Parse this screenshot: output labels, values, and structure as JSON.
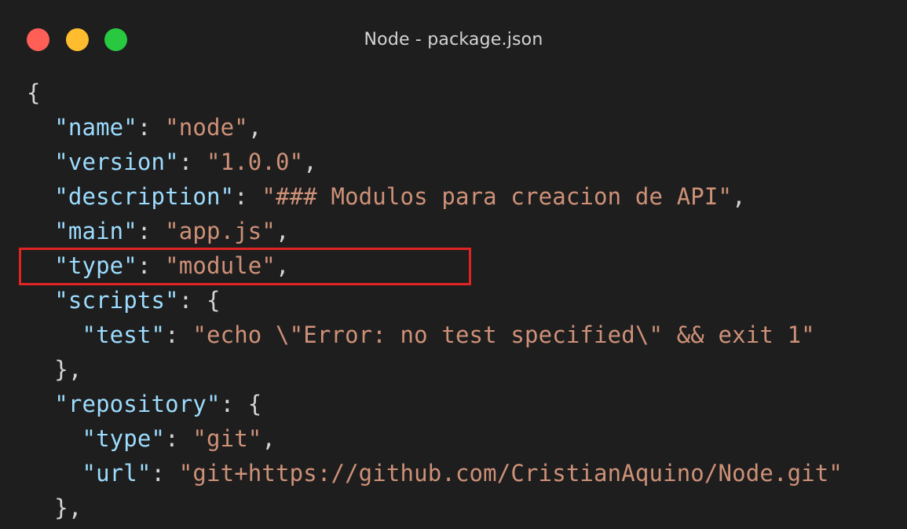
{
  "window": {
    "title": "Node - package.json",
    "traffic_lights": [
      {
        "name": "close",
        "color": "#ff5f57"
      },
      {
        "name": "minimize",
        "color": "#febc2e"
      },
      {
        "name": "maximize",
        "color": "#28c840"
      }
    ]
  },
  "colors": {
    "background": "#1e1e1e",
    "key": "#9cdcfe",
    "string": "#ce9178",
    "punctuation": "#d4d4d4",
    "highlight_border": "#e02424"
  },
  "code": {
    "lines": [
      [
        {
          "t": "p",
          "v": "{"
        }
      ],
      [
        {
          "t": "p",
          "v": "  "
        },
        {
          "t": "k",
          "v": "\"name\""
        },
        {
          "t": "p",
          "v": ": "
        },
        {
          "t": "s",
          "v": "\"node\""
        },
        {
          "t": "p",
          "v": ","
        }
      ],
      [
        {
          "t": "p",
          "v": "  "
        },
        {
          "t": "k",
          "v": "\"version\""
        },
        {
          "t": "p",
          "v": ": "
        },
        {
          "t": "s",
          "v": "\"1.0.0\""
        },
        {
          "t": "p",
          "v": ","
        }
      ],
      [
        {
          "t": "p",
          "v": "  "
        },
        {
          "t": "k",
          "v": "\"description\""
        },
        {
          "t": "p",
          "v": ": "
        },
        {
          "t": "s",
          "v": "\"### Modulos para creacion de API\""
        },
        {
          "t": "p",
          "v": ","
        }
      ],
      [
        {
          "t": "p",
          "v": "  "
        },
        {
          "t": "k",
          "v": "\"main\""
        },
        {
          "t": "p",
          "v": ": "
        },
        {
          "t": "s",
          "v": "\"app.js\""
        },
        {
          "t": "p",
          "v": ","
        }
      ],
      [
        {
          "t": "p",
          "v": "  "
        },
        {
          "t": "k",
          "v": "\"type\""
        },
        {
          "t": "p",
          "v": ": "
        },
        {
          "t": "s",
          "v": "\"module\""
        },
        {
          "t": "p",
          "v": ","
        }
      ],
      [
        {
          "t": "p",
          "v": "  "
        },
        {
          "t": "k",
          "v": "\"scripts\""
        },
        {
          "t": "p",
          "v": ": {"
        }
      ],
      [
        {
          "t": "p",
          "v": "    "
        },
        {
          "t": "k",
          "v": "\"test\""
        },
        {
          "t": "p",
          "v": ": "
        },
        {
          "t": "s",
          "v": "\"echo \\\"Error: no test specified\\\" && exit 1\""
        }
      ],
      [
        {
          "t": "p",
          "v": "  },"
        }
      ],
      [
        {
          "t": "p",
          "v": "  "
        },
        {
          "t": "k",
          "v": "\"repository\""
        },
        {
          "t": "p",
          "v": ": {"
        }
      ],
      [
        {
          "t": "p",
          "v": "    "
        },
        {
          "t": "k",
          "v": "\"type\""
        },
        {
          "t": "p",
          "v": ": "
        },
        {
          "t": "s",
          "v": "\"git\""
        },
        {
          "t": "p",
          "v": ","
        }
      ],
      [
        {
          "t": "p",
          "v": "    "
        },
        {
          "t": "k",
          "v": "\"url\""
        },
        {
          "t": "p",
          "v": ": "
        },
        {
          "t": "s",
          "v": "\"git+https://github.com/CristianAquino/Node.git\""
        }
      ],
      [
        {
          "t": "p",
          "v": "  },"
        }
      ]
    ]
  }
}
